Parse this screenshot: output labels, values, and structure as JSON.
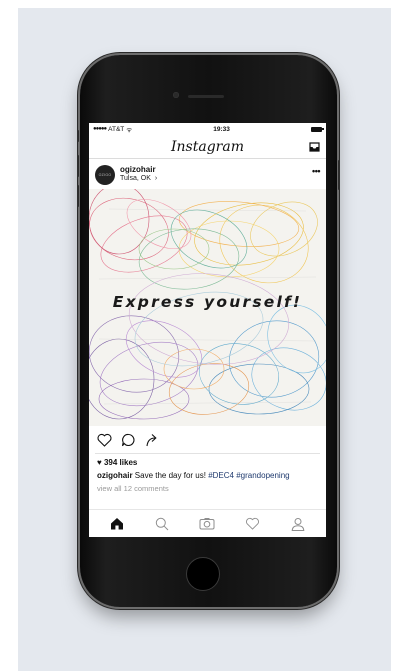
{
  "status_bar": {
    "signal": "●●●●●",
    "carrier": "AT&T",
    "wifi": "ᯤ",
    "time": "19:33"
  },
  "nav": {
    "title": "Instagram"
  },
  "post": {
    "avatar_text": "OZIGO",
    "username": "ogizohair",
    "location": "Tulsa, OK",
    "location_chevron": "›",
    "more": "•••",
    "image_text": "Express yourself!"
  },
  "likes": "394 likes",
  "caption": {
    "user": "ozigohair",
    "text": "Save the day for us!",
    "tag1": "#DEC4",
    "tag2": "#grandopening"
  },
  "comments_link": "view all 12 comments",
  "icons": {
    "nav": [
      "inbox-icon"
    ],
    "actions": [
      "heart-icon",
      "comment-icon",
      "share-icon"
    ],
    "tabs": [
      "home-icon",
      "search-icon",
      "camera-icon",
      "activity-heart-icon",
      "profile-icon"
    ]
  },
  "colors": {
    "hashtag": "#1f3a6e",
    "background_panel": "#e4e8ee"
  }
}
